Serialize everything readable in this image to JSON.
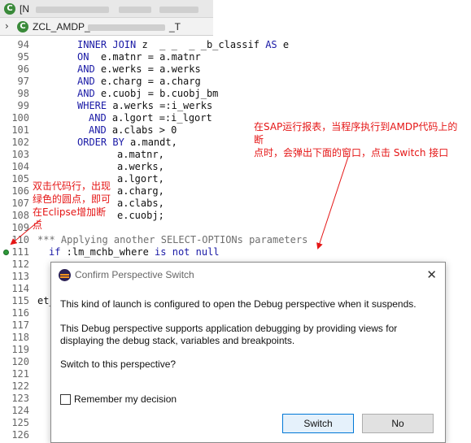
{
  "tabs": {
    "file_tab_prefix": "[N",
    "editor_tab_prefix": "ZCL_AMDP_",
    "editor_tab_suffix": "_T"
  },
  "code": {
    "line_numbers": [
      "94",
      "95",
      "96",
      "97",
      "98",
      "99",
      "100",
      "101",
      "102",
      "103",
      "104",
      "105",
      "106",
      "107",
      "108",
      "109",
      "110",
      "111",
      "112",
      "113",
      "114",
      "115",
      "116",
      "117",
      "118",
      "119",
      "120",
      "121",
      "122",
      "123",
      "124",
      "125",
      "126"
    ],
    "lines": {
      "l94_kw1": "INNER JOIN",
      "l94_mid": " z  _ _  _ _b_classif ",
      "l94_kw2": "AS",
      "l94_end": " e",
      "l95_kw": "ON",
      "l95_rest": "  e.matnr = a.matnr",
      "l96_kw": "AND",
      "l96_rest": " e.werks = a.werks",
      "l97_kw": "AND",
      "l97_rest": " e.charg = a.charg",
      "l98_kw": "AND",
      "l98_rest": " e.cuobj = b.cuobj_bm",
      "l99_kw": "WHERE",
      "l99_rest": " a.werks =:i_werks",
      "l100_kw": "AND",
      "l100_rest": " a.lgort =:i_lgort",
      "l101_kw": "AND",
      "l101_rest": " a.clabs > 0",
      "l102_kw": "ORDER BY",
      "l102_rest": " a.mandt,",
      "l103": "a.matnr,",
      "l104": "a.werks,",
      "l105": "a.lgort,",
      "l106": "a.charg,",
      "l107": "a.clabs,",
      "l108": "e.cuobj;",
      "l110_comment": "*** Applying another SELECT-OPTIONs parameters",
      "l111_kw1": "if",
      "l111_mid": " :lm_mchb_where ",
      "l111_kw2": "is not null",
      "l115": "et_"
    }
  },
  "annotations": {
    "left_note": [
      "双击代码行，出现",
      "绿色的圆点，即可",
      "在Eclipse增加断点"
    ],
    "right_note": [
      "在SAP运行报表，当程序执行到AMDP代码上的断",
      "点时，会弹出下面的窗口，点击 Switch 接口"
    ]
  },
  "dialog": {
    "title": "Confirm Perspective Switch",
    "message1": "This kind of launch is configured to open the Debug perspective when it suspends.",
    "message2": "This Debug perspective supports application debugging by providing views for displaying the debug stack, variables and breakpoints.",
    "question": "Switch to this perspective?",
    "remember_label": "Remember my decision",
    "remember_checked": false,
    "switch_label": "Switch",
    "no_label": "No",
    "close_glyph": "✕"
  },
  "colors": {
    "keyword": "#1a1aa6",
    "comment": "#6f6f6f",
    "annotation": "#e51616",
    "breakpoint": "#2e9a3a",
    "primary_button_border": "#0078d7"
  }
}
